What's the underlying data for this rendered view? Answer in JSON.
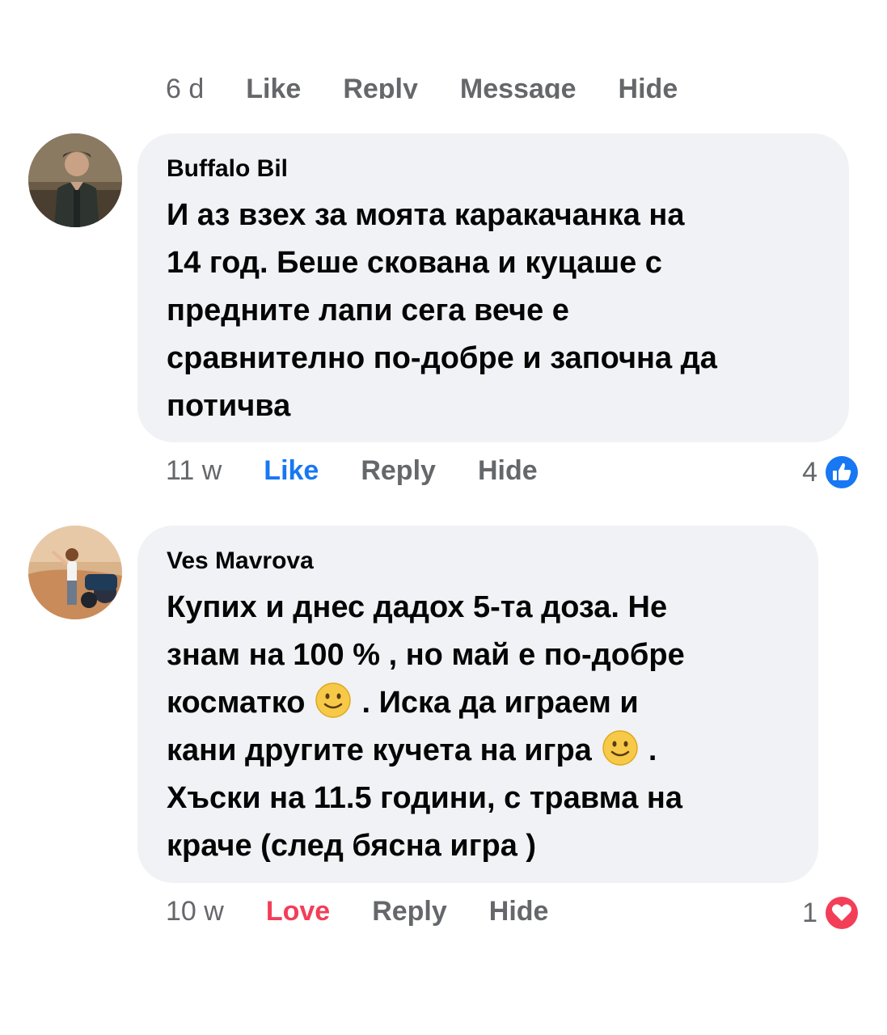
{
  "top_bar": {
    "time": "6 d",
    "like": "Like",
    "reply": "Reply",
    "message": "Message",
    "hide": "Hide"
  },
  "comments": [
    {
      "author": "Buffalo Bil",
      "lines": [
        "И аз взех за моята каракачанка на",
        "14 год. Беше скована и куцаше с",
        "предните лапи сега вече е",
        "сравнително по-добре и започна да",
        "потичва"
      ],
      "time": "11 w",
      "reaction_action": "Like",
      "reply": "Reply",
      "hide": "Hide",
      "reaction_count": "4",
      "reaction_icon": "like-icon",
      "reaction_color": "#1877f2"
    },
    {
      "author": "Ves Mavrova",
      "line1": "Купих и днес дадох 5-та доза. Не",
      "line2": "знам на 100 % , но май е по-добре",
      "line3a": "косматко",
      "line3b": ". Иска да играем и",
      "line4a": "кани другите кучета на игра",
      "line4b": ".",
      "line5": "Хъски на 11.5 години,  с травма на",
      "line6": "краче (след бясна игра )",
      "time": "10 w",
      "reaction_action": "Love",
      "reply": "Reply",
      "hide": "Hide",
      "reaction_count": "1",
      "reaction_icon": "love-icon",
      "reaction_color": "#f33e58"
    }
  ],
  "colors": {
    "bubble": "#f0f2f5",
    "meta_text": "#65676b",
    "like_blue": "#1877f2",
    "love_red": "#f33e58"
  }
}
